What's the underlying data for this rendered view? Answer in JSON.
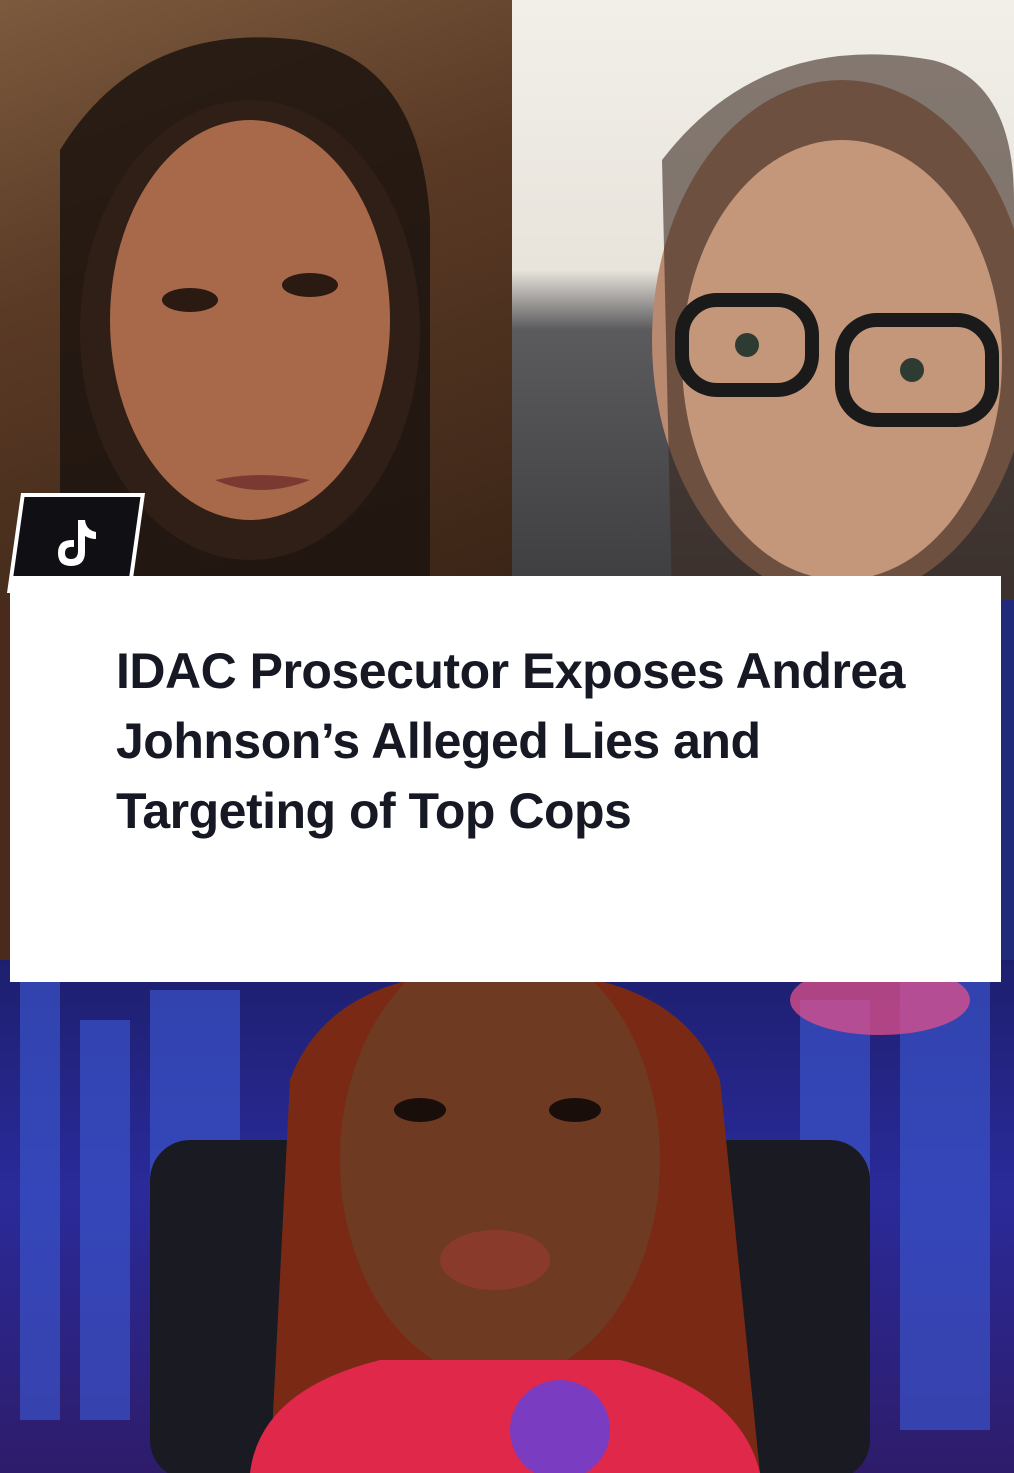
{
  "caption": {
    "title": "IDAC Prosecutor Exposes Andrea Johnson’s Alleged Lies and Targeting of Top Cops"
  },
  "badge": {
    "icon": "tiktok-logo-icon"
  },
  "colors": {
    "caption_background": "#ffffff",
    "caption_text": "#161823",
    "badge_background": "#0f0f14"
  }
}
